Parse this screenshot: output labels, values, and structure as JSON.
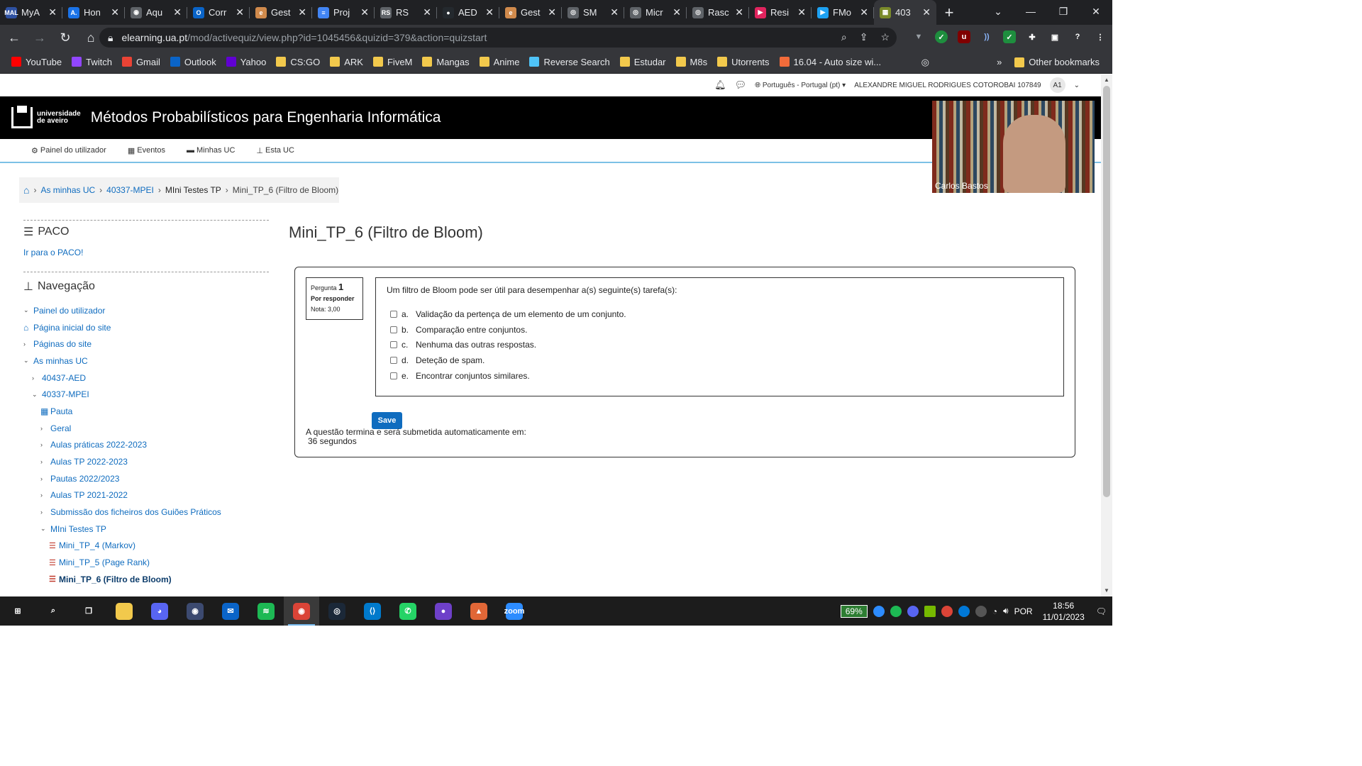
{
  "browser": {
    "tabs": [
      {
        "title": "MyA",
        "icon": "mal-icon",
        "color": "#2e51a2",
        "glyph": "MAL"
      },
      {
        "title": "Hon",
        "icon": "doc-icon",
        "color": "#1a73e8",
        "glyph": "A."
      },
      {
        "title": "Aqu",
        "icon": "game-icon",
        "color": "#5f6368",
        "glyph": "◉"
      },
      {
        "title": "Corr",
        "icon": "outlook-icon",
        "color": "#0a64c8",
        "glyph": "O"
      },
      {
        "title": "Gest",
        "icon": "elearning-icon",
        "color": "#d08a4c",
        "glyph": "e"
      },
      {
        "title": "Proj",
        "icon": "docs-icon",
        "color": "#4285f4",
        "glyph": "≡"
      },
      {
        "title": "RS",
        "icon": "rs-icon",
        "color": "#5f6368",
        "glyph": "RS"
      },
      {
        "title": "AED",
        "icon": "github-icon",
        "color": "#24292e",
        "glyph": "●"
      },
      {
        "title": "Gest",
        "icon": "elearning-icon",
        "color": "#d08a4c",
        "glyph": "e"
      },
      {
        "title": "SM",
        "icon": "globe-icon",
        "color": "#5f6368",
        "glyph": "◎"
      },
      {
        "title": "Micr",
        "icon": "globe-icon",
        "color": "#5f6368",
        "glyph": "◎"
      },
      {
        "title": "Rasc",
        "icon": "globe-icon",
        "color": "#5f6368",
        "glyph": "◎"
      },
      {
        "title": "Resi",
        "icon": "play-icon",
        "color": "#e0245e",
        "glyph": "▶"
      },
      {
        "title": "FMo",
        "icon": "play-icon",
        "color": "#1da1f2",
        "glyph": "▶"
      },
      {
        "title": "403",
        "icon": "moodle-icon",
        "color": "#7a8a2a",
        "glyph": "▦"
      }
    ],
    "url_host": "elearning.ua.pt",
    "url_path": "/mod/activequiz/view.php?id=1045456&quizid=379&action=quizstart",
    "bookmarks": [
      {
        "label": "YouTube",
        "icon": "youtube-icon",
        "color": "#ff0000"
      },
      {
        "label": "Twitch",
        "icon": "twitch-icon",
        "color": "#9146ff"
      },
      {
        "label": "Gmail",
        "icon": "gmail-icon",
        "color": "#ea4335"
      },
      {
        "label": "Outlook",
        "icon": "outlook-icon",
        "color": "#0a64c8"
      },
      {
        "label": "Yahoo",
        "icon": "yahoo-icon",
        "color": "#6001d2"
      },
      {
        "label": "CS:GO",
        "icon": "folder-icon",
        "color": "#f2c94c"
      },
      {
        "label": "ARK",
        "icon": "folder-icon",
        "color": "#f2c94c"
      },
      {
        "label": "FiveM",
        "icon": "folder-icon",
        "color": "#f2c94c"
      },
      {
        "label": "Mangas",
        "icon": "folder-icon",
        "color": "#f2c94c"
      },
      {
        "label": "Anime",
        "icon": "folder-icon",
        "color": "#f2c94c"
      },
      {
        "label": "Reverse Search",
        "icon": "reverse-search-icon",
        "color": "#4fc3f7"
      },
      {
        "label": "Estudar",
        "icon": "folder-icon",
        "color": "#f2c94c"
      },
      {
        "label": "M8s",
        "icon": "folder-icon",
        "color": "#f2c94c"
      },
      {
        "label": "Utorrents",
        "icon": "folder-icon",
        "color": "#f2c94c"
      },
      {
        "label": "16.04 - Auto size wi...",
        "icon": "ask-icon",
        "color": "#f26b3a"
      }
    ],
    "other_bookmarks": "Other bookmarks",
    "more": "»"
  },
  "moodle": {
    "language": "Português - Portugal (pt)",
    "user_name": "ALEXANDRE MIGUEL RODRIGUES COTOROBAI 107849",
    "user_initials": "A1",
    "logo_line1": "universidade",
    "logo_line2": "de aveiro",
    "course_title": "Métodos Probabilísticos para Engenharia Informática",
    "menu": [
      "Painel do utilizador",
      "Eventos",
      "Minhas UC",
      "Esta UC"
    ],
    "breadcrumb": [
      "As minhas UC",
      "40337-MPEI",
      "MIni Testes TP",
      "Mini_TP_6 (Filtro de Bloom)"
    ],
    "video_name": "Carlos Bastos"
  },
  "sidebar": {
    "paco_title": "PACO",
    "paco_link": "Ir para o PACO!",
    "nav_title": "Navegação",
    "items": [
      {
        "label": "Painel do utilizador",
        "indent": 0,
        "caret": "v"
      },
      {
        "label": "Página inicial do site",
        "indent": 0,
        "caret": "home"
      },
      {
        "label": "Páginas do site",
        "indent": 0,
        "caret": ">"
      },
      {
        "label": "As minhas UC",
        "indent": 0,
        "caret": "v"
      },
      {
        "label": "40437-AED",
        "indent": 1,
        "caret": ">"
      },
      {
        "label": "40337-MPEI",
        "indent": 1,
        "caret": "v"
      },
      {
        "label": "Pauta",
        "indent": 2,
        "caret": "table"
      },
      {
        "label": "Geral",
        "indent": 2,
        "caret": ">"
      },
      {
        "label": "Aulas práticas 2022-2023",
        "indent": 2,
        "caret": ">"
      },
      {
        "label": "Aulas TP 2022-2023",
        "indent": 2,
        "caret": ">"
      },
      {
        "label": "Pautas 2022/2023",
        "indent": 2,
        "caret": ">"
      },
      {
        "label": "Aulas TP 2021-2022",
        "indent": 2,
        "caret": ">"
      },
      {
        "label": "Submissão dos ficheiros dos Guiões Práticos",
        "indent": 2,
        "caret": ">"
      },
      {
        "label": "MIni Testes TP",
        "indent": 2,
        "caret": "v"
      },
      {
        "label": "Mini_TP_4 (Markov)",
        "indent": 3,
        "caret": "quiz"
      },
      {
        "label": "Mini_TP_5 (Page Rank)",
        "indent": 3,
        "caret": "quiz"
      },
      {
        "label": "Mini_TP_6 (Filtro de Bloom)",
        "indent": 3,
        "caret": "quiz",
        "current": true
      }
    ]
  },
  "quiz": {
    "title": "Mini_TP_6 (Filtro de Bloom)",
    "question_label": "Pergunta",
    "question_number": "1",
    "state": "Por responder",
    "grade": "Nota: 3,00",
    "prompt": "Um filtro de Bloom pode ser útil para desempenhar a(s) seguinte(s) tarefa(s):",
    "options": [
      {
        "letter": "a.",
        "text": "Validação da pertença de um elemento de um conjunto."
      },
      {
        "letter": "b.",
        "text": "Comparação entre conjuntos."
      },
      {
        "letter": "c.",
        "text": "Nenhuma das outras respostas."
      },
      {
        "letter": "d.",
        "text": "Deteção de spam."
      },
      {
        "letter": "e.",
        "text": "Encontrar conjuntos similares."
      }
    ],
    "save_label": "Save",
    "timer_text": "A questão termina e será submetida automaticamente em:",
    "timer_value": "36 segundos"
  },
  "taskbar": {
    "apps": [
      {
        "name": "start-icon",
        "color": "#1c1c1c",
        "glyph": "⊞"
      },
      {
        "name": "search-icon",
        "color": "#1c1c1c",
        "glyph": "⌕"
      },
      {
        "name": "task-view-icon",
        "color": "#1c1c1c",
        "glyph": "❐"
      },
      {
        "name": "file-explorer-icon",
        "color": "#f2c94c",
        "glyph": ""
      },
      {
        "name": "discord-icon",
        "color": "#5865f2",
        "glyph": "◕"
      },
      {
        "name": "obs-icon",
        "color": "#3c4a70",
        "glyph": "◉"
      },
      {
        "name": "mail-icon",
        "color": "#0a64c8",
        "glyph": "✉"
      },
      {
        "name": "spotify-icon",
        "color": "#1db954",
        "glyph": "≋"
      },
      {
        "name": "chrome-icon",
        "color": "#db4437",
        "glyph": "◉"
      },
      {
        "name": "steam-icon",
        "color": "#1b2838",
        "glyph": "◎"
      },
      {
        "name": "vscode-icon",
        "color": "#007acc",
        "glyph": "⟨⟩"
      },
      {
        "name": "whatsapp-icon",
        "color": "#25d366",
        "glyph": "✆"
      },
      {
        "name": "github-desktop-icon",
        "color": "#6e40c9",
        "glyph": "●"
      },
      {
        "name": "matlab-icon",
        "color": "#e16737",
        "glyph": "▲"
      },
      {
        "name": "zoom-icon",
        "color": "#2d8cff",
        "glyph": "zoom"
      }
    ],
    "battery": "69%",
    "language": "POR",
    "time": "18:56",
    "date": "11/01/2023"
  }
}
